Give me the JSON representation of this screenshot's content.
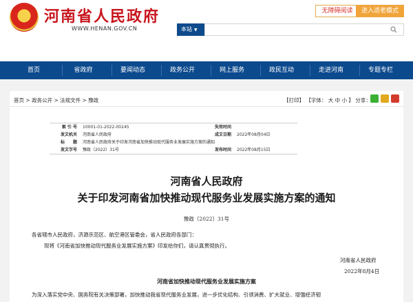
{
  "header": {
    "site_title": "河南省人民政府",
    "site_url": "WWW.HENAN.GOV.CN",
    "accessibility_label": "无障碍阅读",
    "elder_mode_label": "进入适老模式",
    "search_scope": "本站",
    "search_placeholder": ""
  },
  "nav": {
    "items": [
      "首页",
      "省政府",
      "要闻动态",
      "政务公开",
      "网上服务",
      "政民互动",
      "走进河南",
      "专题专栏"
    ]
  },
  "breadcrumb": {
    "items": [
      "首页",
      "政务公开",
      "法规文件",
      "豫政"
    ],
    "sep": ">"
  },
  "tools": {
    "print": "【打印】",
    "font_label": "【字体：",
    "font_large": "大",
    "font_medium": "中",
    "font_small": "小",
    "font_close": "】",
    "share_label": "分享："
  },
  "meta": {
    "index_label": "索 引 号",
    "index_value": "10001-01-2022-00245",
    "invalid_label": "失效时间",
    "invalid_value": "",
    "issuer_label": "发文机关",
    "issuer_value": "河南省人民政府",
    "written_label": "成文日期",
    "written_value": "2022年08月04日",
    "title_label": "标　　题",
    "title_value": "河南省人民政府关于印发河南省加快推动现代服务业发展实施方案的通知",
    "docno_label": "发文字号",
    "docno_value": "豫政〔2022〕31号",
    "publish_label": "发布时间",
    "publish_value": "2022年08月15日"
  },
  "doc": {
    "title_line1": "河南省人民政府",
    "title_line2": "关于印发河南省加快推动现代服务业发展实施方案的通知",
    "doc_number": "豫政〔2022〕31号",
    "addressees": "各省辖市人民政府，济源示范区、航空港区管委会，省人民政府各部门：",
    "body": "现将《河南省加快推动现代服务业发展实施方案》印发给你们，请认真贯彻执行。",
    "signature_org": "河南省人民政府",
    "signature_date": "2022年8月4日",
    "plan_title": "河南省加快推动现代服务业发展实施方案",
    "plan_intro": "为深入落实党中央、国务院有关决策部署，加快推动我省现代服务业发展，进一步优化结构、引领消费、扩大就业、增强经济韧"
  },
  "colors": {
    "brand_red": "#c8151d",
    "nav_blue": "#0c4a8e",
    "accent_orange": "#f0a43a"
  }
}
